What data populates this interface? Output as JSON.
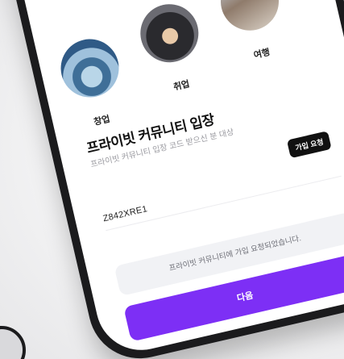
{
  "categories": [
    {
      "label": "창업",
      "icon": "startup-avatar"
    },
    {
      "label": "취업",
      "icon": "job-avatar"
    },
    {
      "label": "여행",
      "icon": "travel-avatar"
    }
  ],
  "section": {
    "title": "프라이빗 커뮤니티 입장",
    "subtitle": "프라이빗 커뮤니티 입장 코드 받으신 분 대상"
  },
  "code_input": {
    "value": "Z842XRE1"
  },
  "join_button": {
    "label": "가입 요청"
  },
  "toast": {
    "message": "프라이빗 커뮤니티에 가입 요청되었습니다."
  },
  "next_button": {
    "label": "다음"
  },
  "colors": {
    "accent": "#7d2ff5",
    "dark": "#111111",
    "toast_bg": "#f1f2f5"
  }
}
